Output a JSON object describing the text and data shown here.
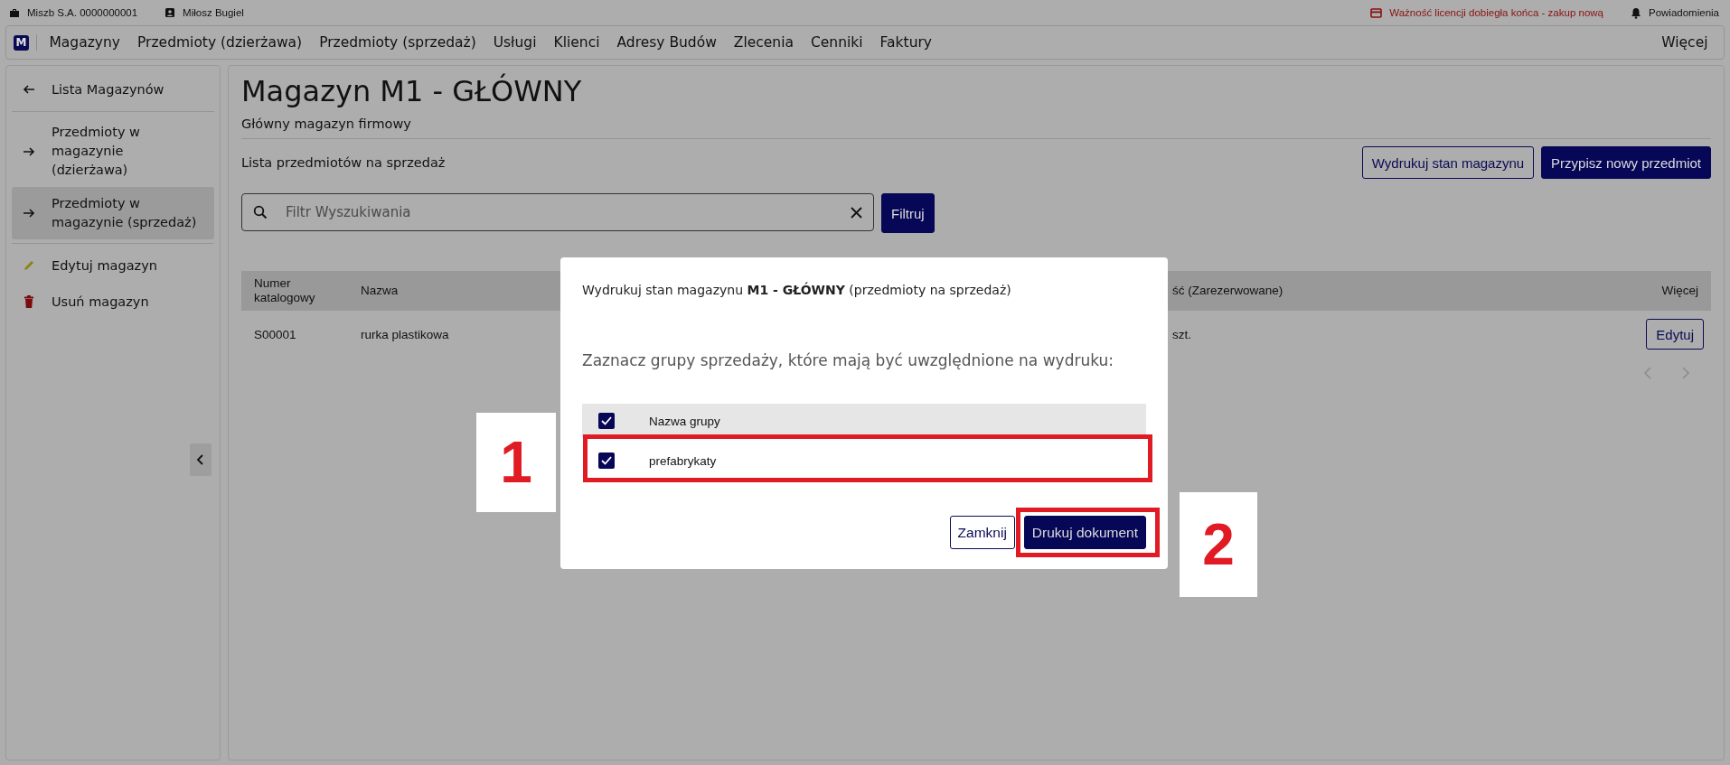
{
  "top_bar": {
    "company": "Miszb S.A. 0000000001",
    "user": "Miłosz Bugiel",
    "license_warning": "Ważność licencji dobiegła końca - zakup nową",
    "notifications": "Powiadomienia"
  },
  "nav": {
    "logo": "M",
    "items": [
      "Magazyny",
      "Przedmioty (dzierżawa)",
      "Przedmioty (sprzedaż)",
      "Usługi",
      "Klienci",
      "Adresy Budów",
      "Zlecenia",
      "Cenniki",
      "Faktury"
    ],
    "more": "Więcej"
  },
  "sidebar": {
    "items": [
      {
        "kind": "back",
        "label": "Lista Magazynów",
        "selected": false
      },
      {
        "kind": "link",
        "label": "Przedmioty w magazynie (dzierżawa)",
        "selected": false
      },
      {
        "kind": "link",
        "label": "Przedmioty w magazynie (sprzedaż)",
        "selected": true
      },
      {
        "kind": "edit",
        "label": "Edytuj magazyn",
        "selected": false
      },
      {
        "kind": "delete",
        "label": "Usuń magazyn",
        "selected": false
      }
    ]
  },
  "main": {
    "title": "Magazyn M1 - GŁÓWNY",
    "subtitle": "Główny magazyn firmowy",
    "list_title": "Lista przedmiotów na sprzedaż",
    "buttons": [
      {
        "kind": "outline",
        "label": "Wydrukuj stan magazynu"
      },
      {
        "kind": "filled",
        "label": "Przypisz nowy przedmiot"
      }
    ],
    "search": {
      "placeholder": "Filtr Wyszukiwania",
      "button": "Filtruj"
    },
    "table": {
      "columns": [
        "Numer katalogowy",
        "Nazwa",
        "ść (Zarezerwowane)",
        "Więcej"
      ],
      "rows": [
        {
          "cells": [
            "S00001",
            "rurka plastikowa",
            "szt."
          ],
          "action": "Edytuj"
        }
      ]
    }
  },
  "modal": {
    "title": "Wydrukuj stan magazynu **M1 - GŁÓWNY** (przedmioty na sprzedaż)",
    "question": "Zaznacz grupy sprzedaży, które mają być uwzględnione na wydruku:",
    "header": {
      "label": "Nazwa grupy",
      "checked": true
    },
    "groups": [
      {
        "label": "prefabrykaty",
        "checked": true
      }
    ],
    "buttons": [
      {
        "kind": "outline",
        "label": "Zamknij"
      },
      {
        "kind": "filled",
        "label": "Drukuj dokument"
      }
    ]
  },
  "annotations": [
    {
      "label": "1"
    },
    {
      "label": "2"
    }
  ]
}
